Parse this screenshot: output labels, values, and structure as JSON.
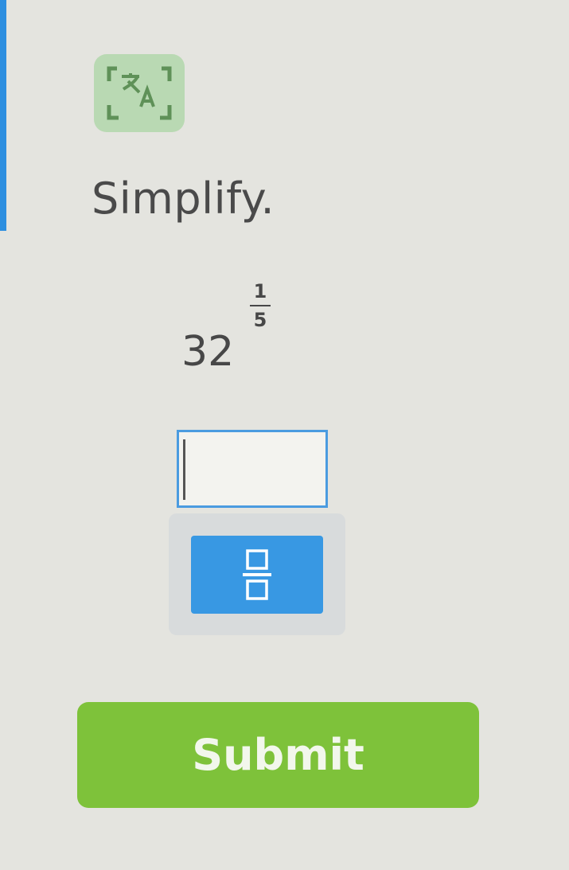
{
  "question": {
    "prompt": "Simplify.",
    "expression": {
      "base": "32",
      "exponent_numerator": "1",
      "exponent_denominator": "5"
    }
  },
  "answer": {
    "value": "",
    "placeholder": ""
  },
  "keypad": {
    "fraction_button_icon": "fraction-template-icon"
  },
  "submit": {
    "label": "Submit"
  },
  "icons": {
    "translate": "translate-icon"
  },
  "colors": {
    "accent_blue": "#3898e3",
    "submit_green": "#7ec23a",
    "translate_bg": "#b9d9b3"
  }
}
